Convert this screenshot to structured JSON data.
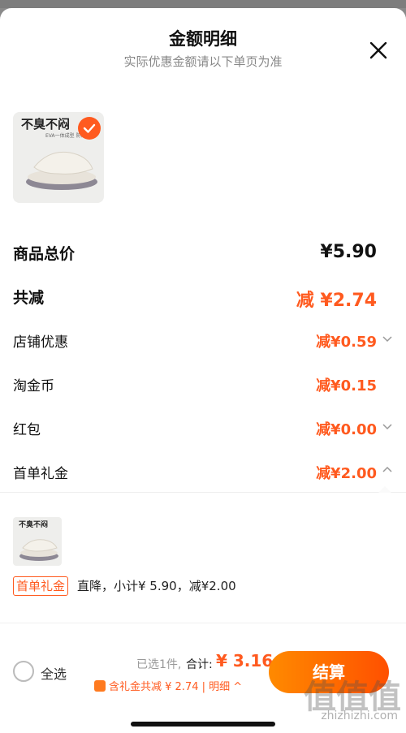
{
  "header": {
    "title": "金额明细",
    "subtitle": "实际优惠金额请以下单页为准"
  },
  "product": {
    "image_text": "不臭不闷",
    "image_subtext": "EVA一体成型 防滑防臭"
  },
  "summary": {
    "total_label": "商品总价",
    "total_value": "¥5.90",
    "reduce_label": "共减",
    "reduce_value": "减 ¥2.74"
  },
  "discounts": [
    {
      "label": "店铺优惠",
      "value": "减¥0.59",
      "chevron": "down"
    },
    {
      "label": "淘金币",
      "value": "减¥0.15",
      "chevron": "none"
    },
    {
      "label": "红包",
      "value": "减¥0.00",
      "chevron": "down"
    },
    {
      "label": "首单礼金",
      "value": "减¥2.00",
      "chevron": "up"
    }
  ],
  "expanded": {
    "image_text": "不臭不闷",
    "tag": "首单礼金",
    "desc": "直降，小计¥ 5.90，减¥2.00"
  },
  "footer": {
    "select_all": "全选",
    "selected_count": "已选1件,",
    "sum_label": "合计:",
    "sum_value": "¥ 3.16",
    "gift_line": "含礼金共减 ¥ 2.74 | 明细 ^",
    "checkout": "结算"
  },
  "watermark": {
    "text": "zhizhizhi.com",
    "logo": "值值值"
  },
  "colors": {
    "accent": "#ff5a1f"
  }
}
